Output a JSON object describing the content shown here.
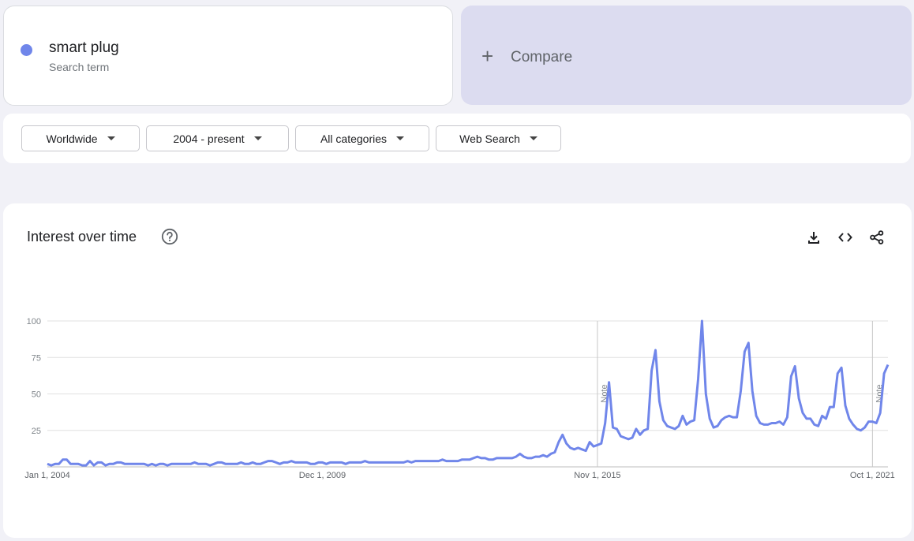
{
  "search_term": {
    "name": "smart plug",
    "label": "Search term",
    "color": "#7086ea"
  },
  "compare": {
    "label": "Compare"
  },
  "filters": {
    "region": "Worldwide",
    "time": "2004 - present",
    "category": "All categories",
    "property": "Web Search"
  },
  "chart": {
    "title": "Interest over time",
    "icons": [
      "help-icon",
      "download-icon",
      "embed-icon",
      "share-icon"
    ]
  },
  "chart_data": {
    "type": "line",
    "title": "Interest over time",
    "xlabel": "",
    "ylabel": "",
    "ylim": [
      0,
      100
    ],
    "yticks": [
      25,
      50,
      75,
      100
    ],
    "xticks": [
      {
        "t": 0,
        "label": "Jan 1, 2004"
      },
      {
        "t": 71,
        "label": "Dec 1, 2009"
      },
      {
        "t": 142,
        "label": "Nov 1, 2015"
      },
      {
        "t": 213,
        "label": "Oct 1, 2021"
      }
    ],
    "notes": [
      {
        "t": 142,
        "label": "Note"
      },
      {
        "t": 213,
        "label": "Note"
      }
    ],
    "grid": true,
    "legend": "none",
    "series": [
      {
        "color": "#7086ea",
        "points": [
          [
            0,
            2
          ],
          [
            1,
            1
          ],
          [
            2,
            2
          ],
          [
            3,
            2
          ],
          [
            4,
            5
          ],
          [
            5,
            5
          ],
          [
            6,
            2
          ],
          [
            7,
            2
          ],
          [
            8,
            2
          ],
          [
            9,
            1
          ],
          [
            10,
            1
          ],
          [
            11,
            4
          ],
          [
            12,
            1
          ],
          [
            13,
            3
          ],
          [
            14,
            3
          ],
          [
            15,
            1
          ],
          [
            16,
            2
          ],
          [
            17,
            2
          ],
          [
            18,
            3
          ],
          [
            19,
            3
          ],
          [
            20,
            2
          ],
          [
            21,
            2
          ],
          [
            22,
            2
          ],
          [
            23,
            2
          ],
          [
            24,
            2
          ],
          [
            25,
            2
          ],
          [
            26,
            1
          ],
          [
            27,
            2
          ],
          [
            28,
            1
          ],
          [
            29,
            2
          ],
          [
            30,
            2
          ],
          [
            31,
            1
          ],
          [
            32,
            2
          ],
          [
            33,
            2
          ],
          [
            34,
            2
          ],
          [
            35,
            2
          ],
          [
            36,
            2
          ],
          [
            37,
            2
          ],
          [
            38,
            3
          ],
          [
            39,
            2
          ],
          [
            40,
            2
          ],
          [
            41,
            2
          ],
          [
            42,
            1
          ],
          [
            43,
            2
          ],
          [
            44,
            3
          ],
          [
            45,
            3
          ],
          [
            46,
            2
          ],
          [
            47,
            2
          ],
          [
            48,
            2
          ],
          [
            49,
            2
          ],
          [
            50,
            3
          ],
          [
            51,
            2
          ],
          [
            52,
            2
          ],
          [
            53,
            3
          ],
          [
            54,
            2
          ],
          [
            55,
            2
          ],
          [
            56,
            3
          ],
          [
            57,
            4
          ],
          [
            58,
            4
          ],
          [
            59,
            3
          ],
          [
            60,
            2
          ],
          [
            61,
            3
          ],
          [
            62,
            3
          ],
          [
            63,
            4
          ],
          [
            64,
            3
          ],
          [
            65,
            3
          ],
          [
            66,
            3
          ],
          [
            67,
            3
          ],
          [
            68,
            2
          ],
          [
            69,
            2
          ],
          [
            70,
            3
          ],
          [
            71,
            3
          ],
          [
            72,
            2
          ],
          [
            73,
            3
          ],
          [
            74,
            3
          ],
          [
            75,
            3
          ],
          [
            76,
            3
          ],
          [
            77,
            2
          ],
          [
            78,
            3
          ],
          [
            79,
            3
          ],
          [
            80,
            3
          ],
          [
            81,
            3
          ],
          [
            82,
            4
          ],
          [
            83,
            3
          ],
          [
            84,
            3
          ],
          [
            85,
            3
          ],
          [
            86,
            3
          ],
          [
            87,
            3
          ],
          [
            88,
            3
          ],
          [
            89,
            3
          ],
          [
            90,
            3
          ],
          [
            91,
            3
          ],
          [
            92,
            3
          ],
          [
            93,
            4
          ],
          [
            94,
            3
          ],
          [
            95,
            4
          ],
          [
            96,
            4
          ],
          [
            97,
            4
          ],
          [
            98,
            4
          ],
          [
            99,
            4
          ],
          [
            100,
            4
          ],
          [
            101,
            4
          ],
          [
            102,
            5
          ],
          [
            103,
            4
          ],
          [
            104,
            4
          ],
          [
            105,
            4
          ],
          [
            106,
            4
          ],
          [
            107,
            5
          ],
          [
            108,
            5
          ],
          [
            109,
            5
          ],
          [
            110,
            6
          ],
          [
            111,
            7
          ],
          [
            112,
            6
          ],
          [
            113,
            6
          ],
          [
            114,
            5
          ],
          [
            115,
            5
          ],
          [
            116,
            6
          ],
          [
            117,
            6
          ],
          [
            118,
            6
          ],
          [
            119,
            6
          ],
          [
            120,
            6
          ],
          [
            121,
            7
          ],
          [
            122,
            9
          ],
          [
            123,
            7
          ],
          [
            124,
            6
          ],
          [
            125,
            6
          ],
          [
            126,
            7
          ],
          [
            127,
            7
          ],
          [
            128,
            8
          ],
          [
            129,
            7
          ],
          [
            130,
            9
          ],
          [
            131,
            10
          ],
          [
            132,
            17
          ],
          [
            133,
            22
          ],
          [
            134,
            16
          ],
          [
            135,
            13
          ],
          [
            136,
            12
          ],
          [
            137,
            13
          ],
          [
            138,
            12
          ],
          [
            139,
            11
          ],
          [
            140,
            17
          ],
          [
            141,
            14
          ],
          [
            142,
            15
          ],
          [
            143,
            16
          ],
          [
            144,
            30
          ],
          [
            145,
            58
          ],
          [
            146,
            27
          ],
          [
            147,
            26
          ],
          [
            148,
            21
          ],
          [
            149,
            20
          ],
          [
            150,
            19
          ],
          [
            151,
            20
          ],
          [
            152,
            26
          ],
          [
            153,
            22
          ],
          [
            154,
            25
          ],
          [
            155,
            26
          ],
          [
            156,
            66
          ],
          [
            157,
            80
          ],
          [
            158,
            45
          ],
          [
            159,
            32
          ],
          [
            160,
            28
          ],
          [
            161,
            27
          ],
          [
            162,
            26
          ],
          [
            163,
            28
          ],
          [
            164,
            35
          ],
          [
            165,
            29
          ],
          [
            166,
            31
          ],
          [
            167,
            32
          ],
          [
            168,
            60
          ],
          [
            169,
            100
          ],
          [
            170,
            50
          ],
          [
            171,
            33
          ],
          [
            172,
            27
          ],
          [
            173,
            28
          ],
          [
            174,
            32
          ],
          [
            175,
            34
          ],
          [
            176,
            35
          ],
          [
            177,
            34
          ],
          [
            178,
            34
          ],
          [
            179,
            52
          ],
          [
            180,
            79
          ],
          [
            181,
            85
          ],
          [
            182,
            52
          ],
          [
            183,
            35
          ],
          [
            184,
            30
          ],
          [
            185,
            29
          ],
          [
            186,
            29
          ],
          [
            187,
            30
          ],
          [
            188,
            30
          ],
          [
            189,
            31
          ],
          [
            190,
            29
          ],
          [
            191,
            34
          ],
          [
            192,
            62
          ],
          [
            193,
            69
          ],
          [
            194,
            47
          ],
          [
            195,
            37
          ],
          [
            196,
            33
          ],
          [
            197,
            33
          ],
          [
            198,
            29
          ],
          [
            199,
            28
          ],
          [
            200,
            35
          ],
          [
            201,
            33
          ],
          [
            202,
            41
          ],
          [
            203,
            41
          ],
          [
            204,
            64
          ],
          [
            205,
            68
          ],
          [
            206,
            42
          ],
          [
            207,
            33
          ],
          [
            208,
            29
          ],
          [
            209,
            26
          ],
          [
            210,
            25
          ],
          [
            211,
            27
          ],
          [
            212,
            31
          ],
          [
            213,
            31
          ],
          [
            214,
            30
          ],
          [
            215,
            37
          ],
          [
            216,
            64
          ],
          [
            217,
            70
          ]
        ]
      }
    ]
  }
}
